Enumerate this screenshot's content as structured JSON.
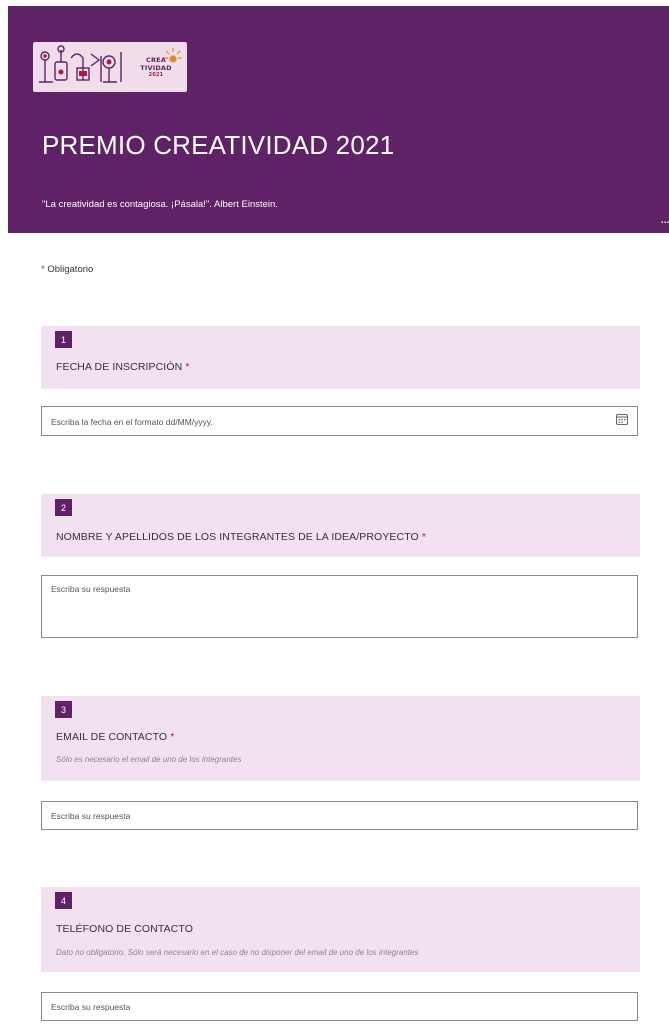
{
  "header": {
    "logo": {
      "word_line1": "CREA",
      "word_line2": "TIVIDAD",
      "year": "2021"
    },
    "title": "PREMIO CREATIVIDAD 2021",
    "subtitle": "\"La creatividad es contagiosa. ¡Pásala!\". Albert Einstein.",
    "more_label": "..."
  },
  "required_note": {
    "star": "*",
    "text": "Obligatorio"
  },
  "questions": [
    {
      "number": "1",
      "label": "FECHA DE INSCRIPCIÓN",
      "required_mark": "*",
      "placeholder": "Escriba la fecha en el formato dd/MM/yyyy.",
      "icon": "calendar-icon"
    },
    {
      "number": "2",
      "label": "NOMBRE Y APELLIDOS DE LOS INTEGRANTES DE LA IDEA/PROYECTO",
      "required_mark": "*",
      "placeholder": "Escriba su respuesta"
    },
    {
      "number": "3",
      "label": "EMAIL DE CONTACTO",
      "required_mark": "*",
      "hint": "Sólo es necesario el email de uno de los integrantes",
      "placeholder": "Escriba su respuesta"
    },
    {
      "number": "4",
      "label": "TELÉFONO DE CONTACTO",
      "hint": "Dato no obligatorio. Sólo será necesario en el caso de no disponer del email  de uno de los integrantes",
      "placeholder": "Escriba su respuesta"
    }
  ],
  "colors": {
    "header_bg": "#5f2266",
    "question_bg": "#f2e2f1",
    "required": "#a4262c"
  }
}
